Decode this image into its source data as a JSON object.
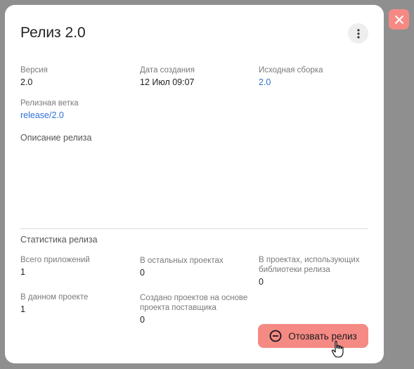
{
  "title": "Релиз 2.0",
  "fields": {
    "version": {
      "label": "Версия",
      "value": "2.0"
    },
    "created": {
      "label": "Дата создания",
      "value": "12 Июл 09:07"
    },
    "source_build": {
      "label": "Исходная сборка",
      "value": "2.0"
    },
    "branch": {
      "label": "Релизная ветка",
      "value": "release/2.0"
    }
  },
  "description_label": "Описание релиза",
  "stats": {
    "title": "Статистика релиза",
    "total_apps": {
      "label": "Всего приложений",
      "value": "1"
    },
    "other_projects": {
      "label": "В остальных проектах",
      "value": "0"
    },
    "projects_using_libs": {
      "label_1": "В проектах, использующих",
      "label_2": "библиотеки релиза",
      "value": "0"
    },
    "this_project": {
      "label": "В данном проекте",
      "value": "1"
    },
    "created_from_vendor": {
      "label_1": "Создано проектов на основе",
      "label_2": "проекта поставщика",
      "value": "0"
    }
  },
  "revoke_label": "Отозвать релиз",
  "colors": {
    "accent": "#f58a84",
    "link": "#2f6fd4"
  },
  "icons": {
    "close": "close-icon",
    "menu": "more-vertical-icon",
    "revoke": "minus-circle-icon"
  }
}
